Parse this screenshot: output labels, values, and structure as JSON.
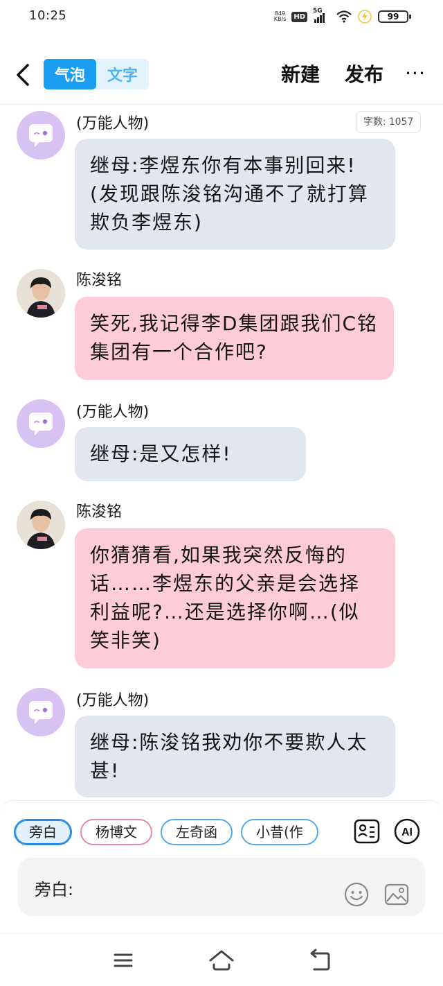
{
  "status_bar": {
    "time": "10:25",
    "net_speed_value": "849",
    "net_speed_unit": "KB/s",
    "hd_label": "HD",
    "network": "5G",
    "battery": "99"
  },
  "header": {
    "mode_tabs": [
      "气泡",
      "文字"
    ],
    "active_mode": "气泡",
    "new_label": "新建",
    "publish_label": "发布",
    "more_label": "···"
  },
  "word_count": {
    "label": "字数:",
    "value": "1057"
  },
  "messages": [
    {
      "sender": "(万能人物)",
      "text": "继母:李煜东你有本事别回来! (发现跟陈浚铭沟通不了就打算欺负李煜东)",
      "style": "grey",
      "avatar": "generic-chat-icon"
    },
    {
      "sender": "陈浚铭",
      "text": "笑死,我记得李D集团跟我们C铭集团有一个合作吧?",
      "style": "pink",
      "avatar": "photo"
    },
    {
      "sender": "(万能人物)",
      "text": "继母:是又怎样!",
      "style": "grey",
      "avatar": "generic-chat-icon"
    },
    {
      "sender": "陈浚铭",
      "text": "你猜猜看,如果我突然反悔的话……李煜东的父亲是会选择利益呢?…还是选择你啊…(似笑非笑)",
      "style": "pink",
      "avatar": "photo"
    },
    {
      "sender": "(万能人物)",
      "text": "继母:陈浚铭我劝你不要欺人太甚!",
      "style": "grey",
      "avatar": "generic-chat-icon"
    }
  ],
  "roles": [
    "旁白",
    "杨博文",
    "左奇函",
    "小昔(作"
  ],
  "active_role": "旁白",
  "input": {
    "prefix": "旁白:"
  },
  "colors": {
    "accent_blue": "#1c9ef0",
    "bubble_grey": "#e2e7ef",
    "bubble_pink": "#fecbd8",
    "avatar_purple": "#d7c2f3"
  }
}
